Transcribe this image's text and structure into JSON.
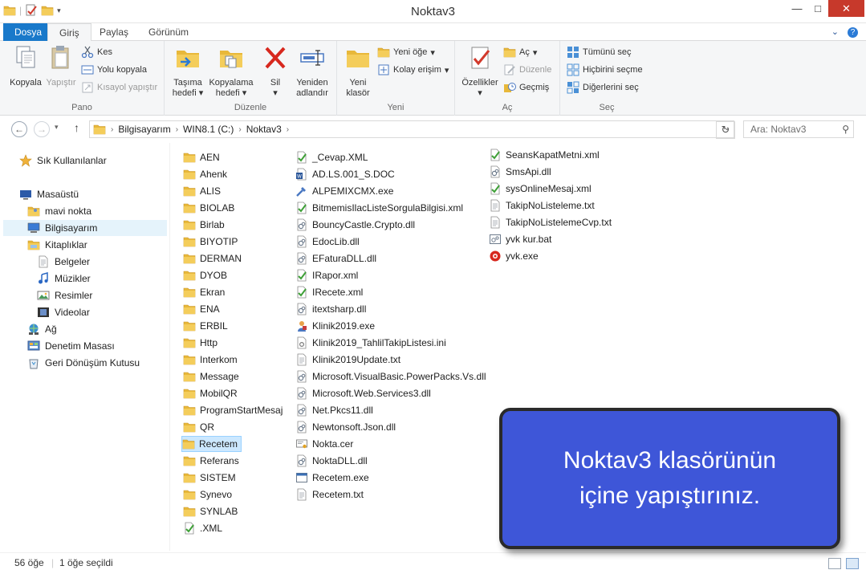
{
  "window": {
    "title": "Noktav3",
    "minimize": "—",
    "maximize": "□",
    "close": "✕"
  },
  "ribbon_tabs": {
    "file": "Dosya",
    "home": "Giriş",
    "share": "Paylaş",
    "view": "Görünüm"
  },
  "ribbon": {
    "pano": {
      "label": "Pano",
      "copy": "Kopyala",
      "paste": "Yapıştır",
      "cut": "Kes",
      "copy_path": "Yolu kopyala",
      "paste_shortcut": "Kısayol yapıştır"
    },
    "duzenle": {
      "label": "Düzenle",
      "move_to_1": "Taşıma",
      "move_to_2": "hedefi",
      "copy_to_1": "Kopyalama",
      "copy_to_2": "hedefi",
      "delete": "Sil",
      "rename_1": "Yeniden",
      "rename_2": "adlandır"
    },
    "yeni": {
      "label": "Yeni",
      "new_folder_1": "Yeni",
      "new_folder_2": "klasör",
      "new_item": "Yeni öğe",
      "easy_access": "Kolay erişim"
    },
    "ac": {
      "label": "Aç",
      "properties": "Özellikler",
      "open": "Aç",
      "edit": "Düzenle",
      "history": "Geçmiş"
    },
    "sec": {
      "label": "Seç",
      "select_all": "Tümünü seç",
      "select_none": "Hiçbirini seçme",
      "invert": "Diğerlerini seç"
    }
  },
  "address": {
    "crumbs": [
      "Bilgisayarım",
      "WIN8.1 (C:)",
      "Noktav3"
    ],
    "search_placeholder": "Ara: Noktav3"
  },
  "navpane": [
    {
      "label": "Sık Kullanılanlar",
      "icon": "star-icon"
    },
    {
      "label": "Masaüstü",
      "icon": "desktop-icon"
    },
    {
      "label": "mavi nokta",
      "icon": "user-folder-icon"
    },
    {
      "label": "Bilgisayarım",
      "icon": "computer-icon"
    },
    {
      "label": "Kitaplıklar",
      "icon": "libraries-icon"
    },
    {
      "label": "Belgeler",
      "icon": "documents-icon"
    },
    {
      "label": "Müzikler",
      "icon": "music-icon"
    },
    {
      "label": "Resimler",
      "icon": "pictures-icon"
    },
    {
      "label": "Videolar",
      "icon": "videos-icon"
    },
    {
      "label": "Ağ",
      "icon": "network-icon"
    },
    {
      "label": "Denetim Masası",
      "icon": "control-panel-icon"
    },
    {
      "label": "Geri Dönüşüm Kutusu",
      "icon": "recycle-bin-icon"
    }
  ],
  "files": {
    "col1": [
      {
        "name": "AEN",
        "type": "folder"
      },
      {
        "name": "Ahenk",
        "type": "folder"
      },
      {
        "name": "ALIS",
        "type": "folder"
      },
      {
        "name": "BIOLAB",
        "type": "folder"
      },
      {
        "name": "Birlab",
        "type": "folder"
      },
      {
        "name": "BIYOTIP",
        "type": "folder"
      },
      {
        "name": "DERMAN",
        "type": "folder"
      },
      {
        "name": "DYOB",
        "type": "folder"
      },
      {
        "name": "Ekran",
        "type": "folder"
      },
      {
        "name": "ENA",
        "type": "folder"
      },
      {
        "name": "ERBIL",
        "type": "folder"
      },
      {
        "name": "Http",
        "type": "folder"
      },
      {
        "name": "Interkom",
        "type": "folder"
      },
      {
        "name": "Message",
        "type": "folder"
      },
      {
        "name": "MobilQR",
        "type": "folder"
      },
      {
        "name": "ProgramStartMesaj",
        "type": "folder"
      },
      {
        "name": "QR",
        "type": "folder"
      },
      {
        "name": "Recetem",
        "type": "folder",
        "selected": true
      },
      {
        "name": "Referans",
        "type": "folder"
      },
      {
        "name": "SISTEM",
        "type": "folder"
      },
      {
        "name": "Synevo",
        "type": "folder"
      },
      {
        "name": "SYNLAB",
        "type": "folder"
      },
      {
        "name": ".XML",
        "type": "xml"
      }
    ],
    "col2": [
      {
        "name": "_Cevap.XML",
        "type": "xml"
      },
      {
        "name": "AD.LS.001_S.DOC",
        "type": "doc"
      },
      {
        "name": "ALPEMIXCMX.exe",
        "type": "tool"
      },
      {
        "name": "BitmemisIlacListeSorgulaBilgisi.xml",
        "type": "xml"
      },
      {
        "name": "BouncyCastle.Crypto.dll",
        "type": "dll"
      },
      {
        "name": "EdocLib.dll",
        "type": "dll"
      },
      {
        "name": "EFaturaDLL.dll",
        "type": "dll"
      },
      {
        "name": "IRapor.xml",
        "type": "xml"
      },
      {
        "name": "IRecete.xml",
        "type": "xml"
      },
      {
        "name": "itextsharp.dll",
        "type": "dll"
      },
      {
        "name": "Klinik2019.exe",
        "type": "app"
      },
      {
        "name": "Klinik2019_TahlilTakipListesi.ini",
        "type": "ini"
      },
      {
        "name": "Klinik2019Update.txt",
        "type": "txt"
      },
      {
        "name": "Microsoft.VisualBasic.PowerPacks.Vs.dll",
        "type": "dll"
      },
      {
        "name": "Microsoft.Web.Services3.dll",
        "type": "dll"
      },
      {
        "name": "Net.Pkcs11.dll",
        "type": "dll"
      },
      {
        "name": "Newtonsoft.Json.dll",
        "type": "dll"
      },
      {
        "name": "Nokta.cer",
        "type": "cert"
      },
      {
        "name": "NoktaDLL.dll",
        "type": "dll"
      },
      {
        "name": "Recetem.exe",
        "type": "exe"
      },
      {
        "name": "Recetem.txt",
        "type": "txt"
      }
    ],
    "col3": [
      {
        "name": "SeansKapatMetni.xml",
        "type": "xml"
      },
      {
        "name": "SmsApi.dll",
        "type": "dll"
      },
      {
        "name": "sysOnlineMesaj.xml",
        "type": "xml"
      },
      {
        "name": "TakipNoListeleme.txt",
        "type": "txt"
      },
      {
        "name": "TakipNoListelemeCvp.txt",
        "type": "txt"
      },
      {
        "name": "yvk kur.bat",
        "type": "bat"
      },
      {
        "name": "yvk.exe",
        "type": "redexe"
      }
    ]
  },
  "status": {
    "count": "56 öğe",
    "selected": "1 öğe seçildi"
  },
  "callout": {
    "line1": "Noktav3 klasörünün",
    "line2": "içine yapıştırınız."
  },
  "colors": {
    "file_tab": "#1979ca",
    "callout_bg": "#3e56d8",
    "close_btn": "#c7392b",
    "selection": "#cce8ff",
    "folder": "#e8b83a"
  }
}
